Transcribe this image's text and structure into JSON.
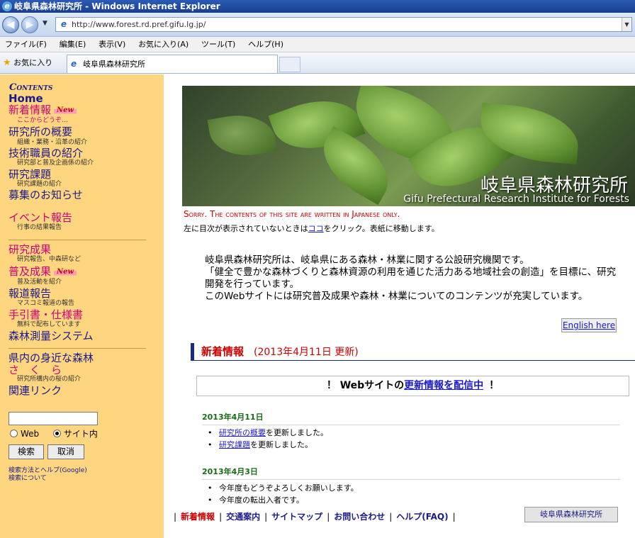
{
  "window": {
    "title": "岐阜県森林研究所 - Windows Internet Explorer",
    "address": "http://www.forest.rd.pref.gifu.lg.jp/",
    "tab_label": "岐阜県森林研究所",
    "favorites_label": "お気に入り"
  },
  "menu": [
    "ファイル(F)",
    "編集(E)",
    "表示(V)",
    "お気に入り(A)",
    "ツール(T)",
    "ヘルプ(H)"
  ],
  "sidebar": {
    "heading": "Contents",
    "home": "Home",
    "new_badge": "New",
    "items": [
      {
        "label": "新着情報",
        "sub": "ここからどうぞ…"
      },
      {
        "label": "研究所の概要",
        "sub": "組織・業務・沿革の紹介"
      },
      {
        "label": "技術職員の紹介",
        "sub": "研究部と普及企画係の紹介"
      },
      {
        "label": "研究課題",
        "sub": "研究課題の紹介"
      },
      {
        "label": "募集のお知らせ"
      },
      {
        "label": "イベント報告",
        "sub": "行事の結果報告"
      },
      {
        "label": "研究成果",
        "sub": "研究報告、中森研など"
      },
      {
        "label": "普及成果",
        "sub": "普及活動を紹介"
      },
      {
        "label": "報道報告",
        "sub": "マスコミ報道の報告"
      },
      {
        "label": "手引書・仕様書",
        "sub": "無料で配布しています"
      },
      {
        "label": "森林測量システム"
      },
      {
        "label": "県内の身近な森林"
      },
      {
        "label": "さ　く　ら",
        "sub": "研究所構内の桜の紹介"
      },
      {
        "label": "関連リンク"
      }
    ],
    "search": {
      "value": "",
      "radio_web": "Web",
      "radio_site": "サイト内",
      "btn_search": "検索",
      "btn_cancel": "取消",
      "help1": "検索方法とヘルプ(Google)",
      "help2": "検索について"
    }
  },
  "banner": {
    "title_jp": "岐阜県森林研究所",
    "title_en": "Gifu Prefectural Research Institute for Forests"
  },
  "notice": {
    "sorry": "Sorry. The contents of this site are written in Japanese only.",
    "text_before": "左に目次が表示されていないときは",
    "link": "ココ",
    "text_after": "をクリック。表紙に移動します。"
  },
  "intro": [
    "岐阜県森林研究所は、岐阜県にある森林・林業に関する公設研究機関です。",
    "「健全で豊かな森林づくりと森林資源の利用を通じた活力ある地域社会の創造」を目標に、研究開発を行っています。",
    "このWebサイトには研究普及成果や森林・林業についてのコンテンツが充実しています。"
  ],
  "english_button": "English here",
  "news": {
    "heading": "新着情報",
    "updated": "(2013年4月11日 更新)",
    "rss_prefix": "！ Webサイトの",
    "rss_link": "更新情報を配信中",
    "rss_suffix": "！",
    "groups": [
      {
        "date": "2013年4月11日",
        "items": [
          {
            "link": "研究所の概要",
            "text": "を更新しました。"
          },
          {
            "link": "研究課題",
            "text": "を更新しました。"
          }
        ]
      },
      {
        "date": "2013年4月3日",
        "items": [
          {
            "link": "",
            "text": "今年度もどうぞよろしくお願いします。"
          },
          {
            "link": "",
            "text": "今年度の転出入者です。"
          }
        ]
      }
    ]
  },
  "footer": {
    "links": [
      "新着情報",
      "交通案内",
      "サイトマップ",
      "お問い合わせ",
      "ヘルプ(FAQ)"
    ],
    "home_button": "岐阜県森林研究所"
  }
}
